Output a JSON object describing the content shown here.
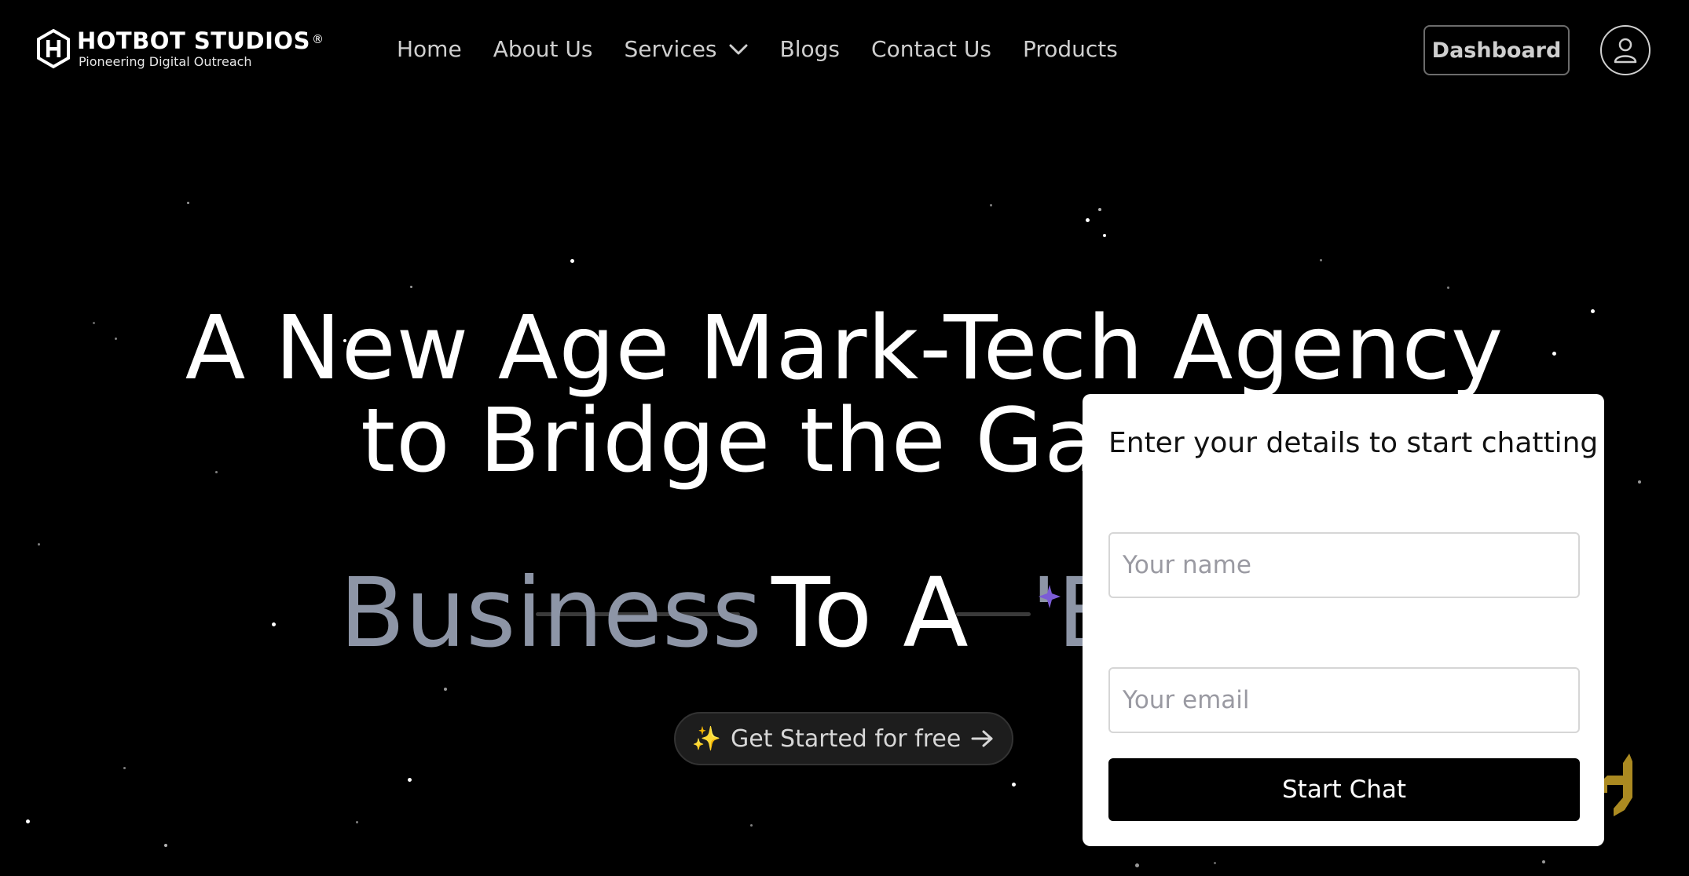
{
  "brand": {
    "name": "HOTBOT STUDIOS",
    "registered": "®",
    "tagline": "Pioneering Digital Outreach"
  },
  "nav": {
    "items": [
      {
        "label": "Home"
      },
      {
        "label": "About Us"
      },
      {
        "label": "Services",
        "has_dropdown": true
      },
      {
        "label": "Blogs"
      },
      {
        "label": "Contact Us"
      },
      {
        "label": "Products"
      }
    ]
  },
  "header": {
    "dashboard_label": "Dashboard",
    "account_icon": "user-icon"
  },
  "hero": {
    "headline_line1": "A New Age Mark-Tech Agency",
    "headline_line2": "to Bridge the Gap",
    "tagline_word1": "Business",
    "tagline_word2": "To A",
    "tagline_fragment": "'E",
    "cta_label": "Get Started for free",
    "cta_icon": "sparkles-icon",
    "cta_arrow_icon": "arrow-right-icon"
  },
  "chat": {
    "title": "Enter your details to start chatting",
    "name_placeholder": "Your name",
    "email_placeholder": "Your email",
    "start_label": "Start Chat"
  },
  "colors": {
    "background": "#000000",
    "nav_text": "#cfcfcf",
    "muted_text": "#8d95a6",
    "cta_accent": "#f3c742",
    "brand_gold": "#c9a227"
  }
}
